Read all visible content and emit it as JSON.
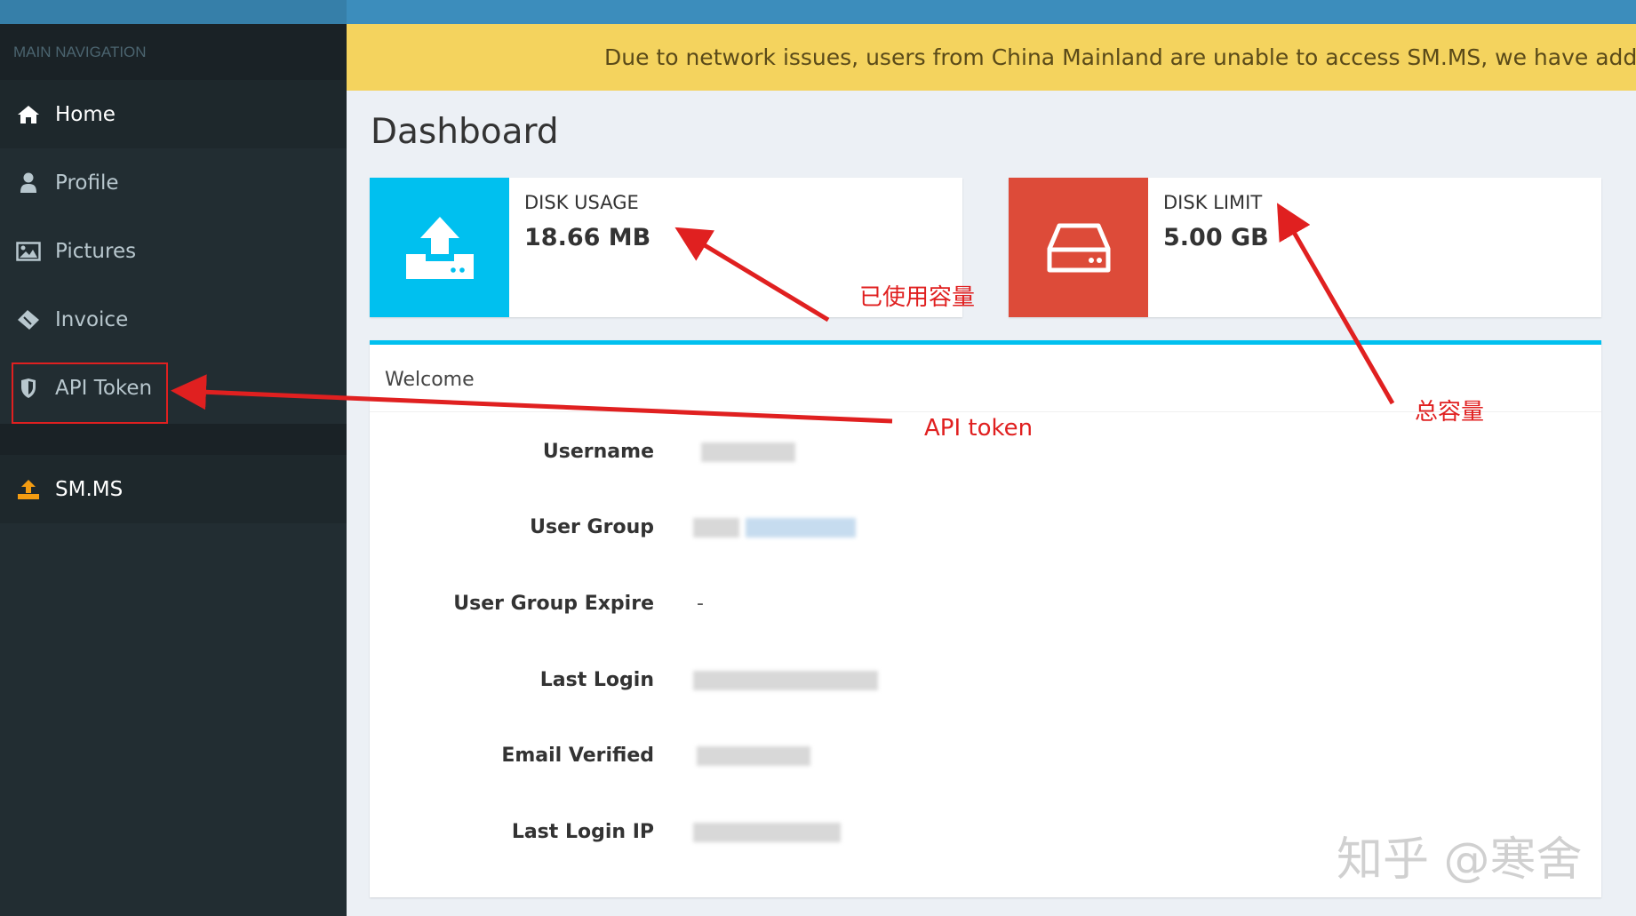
{
  "nav": {
    "header": "MAIN NAVIGATION",
    "items": [
      {
        "label": "Home",
        "icon": "home-icon"
      },
      {
        "label": "Profile",
        "icon": "user-icon"
      },
      {
        "label": "Pictures",
        "icon": "image-icon"
      },
      {
        "label": "Invoice",
        "icon": "ticket-icon"
      },
      {
        "label": "API Token",
        "icon": "shield-icon"
      }
    ],
    "smms": {
      "label": "SM.MS",
      "icon": "upload-icon"
    }
  },
  "notice": "Due to network issues, users from China Mainland are unable to access SM.MS, we have added an alt",
  "page_title": "Dashboard",
  "disk_usage": {
    "label": "DISK USAGE",
    "value": "18.66 MB",
    "color": "#00c0ef"
  },
  "disk_limit": {
    "label": "DISK LIMIT",
    "value": "5.00 GB",
    "color": "#dd4b39"
  },
  "welcome": {
    "title": "Welcome",
    "rows": [
      {
        "label": "Username"
      },
      {
        "label": "User Group"
      },
      {
        "label": "User Group Expire",
        "value": "-"
      },
      {
        "label": "Last Login"
      },
      {
        "label": "Email Verified"
      },
      {
        "label": "Last Login IP"
      }
    ]
  },
  "annotations": {
    "used": "已使用容量",
    "total": "总容量",
    "api": "API token",
    "color": "#e02020"
  },
  "watermark": "知乎 @寒舍"
}
